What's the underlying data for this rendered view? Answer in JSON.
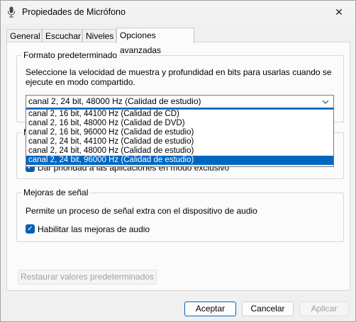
{
  "window": {
    "title": "Propiedades de Micrófono",
    "close_glyph": "✕"
  },
  "tabs": [
    {
      "label": "General"
    },
    {
      "label": "Escuchar"
    },
    {
      "label": "Niveles"
    },
    {
      "label": "Opciones avanzadas"
    }
  ],
  "default_format": {
    "title": "Formato predeterminado",
    "description_line1": "Seleccione la velocidad de muestra y profundidad en bits para usarlas cuando se",
    "description_line2": "ejecute en modo compartido.",
    "selected_value": "canal 2, 24 bit, 48000 Hz (Calidad de estudio)",
    "options": [
      "canal 2, 16 bit, 44100 Hz (Calidad de CD)",
      "canal 2, 16 bit, 48000 Hz (Calidad de DVD)",
      "canal 2, 16 bit, 96000 Hz (Calidad de estudio)",
      "canal 2, 24 bit, 44100 Hz (Calidad de estudio)",
      "canal 2, 24 bit, 48000 Hz (Calidad de estudio)",
      "canal 2, 24 bit, 96000 Hz (Calidad de estudio)"
    ],
    "highlighted_option_index": 5
  },
  "exclusive_mode": {
    "title_partial": "M",
    "priority_label": "Dar prioridad a las aplicaciones en modo exclusivo"
  },
  "signal_enhancements": {
    "title": "Mejoras de señal",
    "description": "Permite un proceso de señal extra con el dispositivo de audio",
    "enable_label": "Habilitar las mejoras de audio",
    "enable_checked": true
  },
  "restore_defaults_label": "Restaurar valores predeterminados",
  "buttons": {
    "accept": "Aceptar",
    "cancel": "Cancelar",
    "apply": "Aplicar"
  },
  "colors": {
    "accent": "#0067c0"
  }
}
